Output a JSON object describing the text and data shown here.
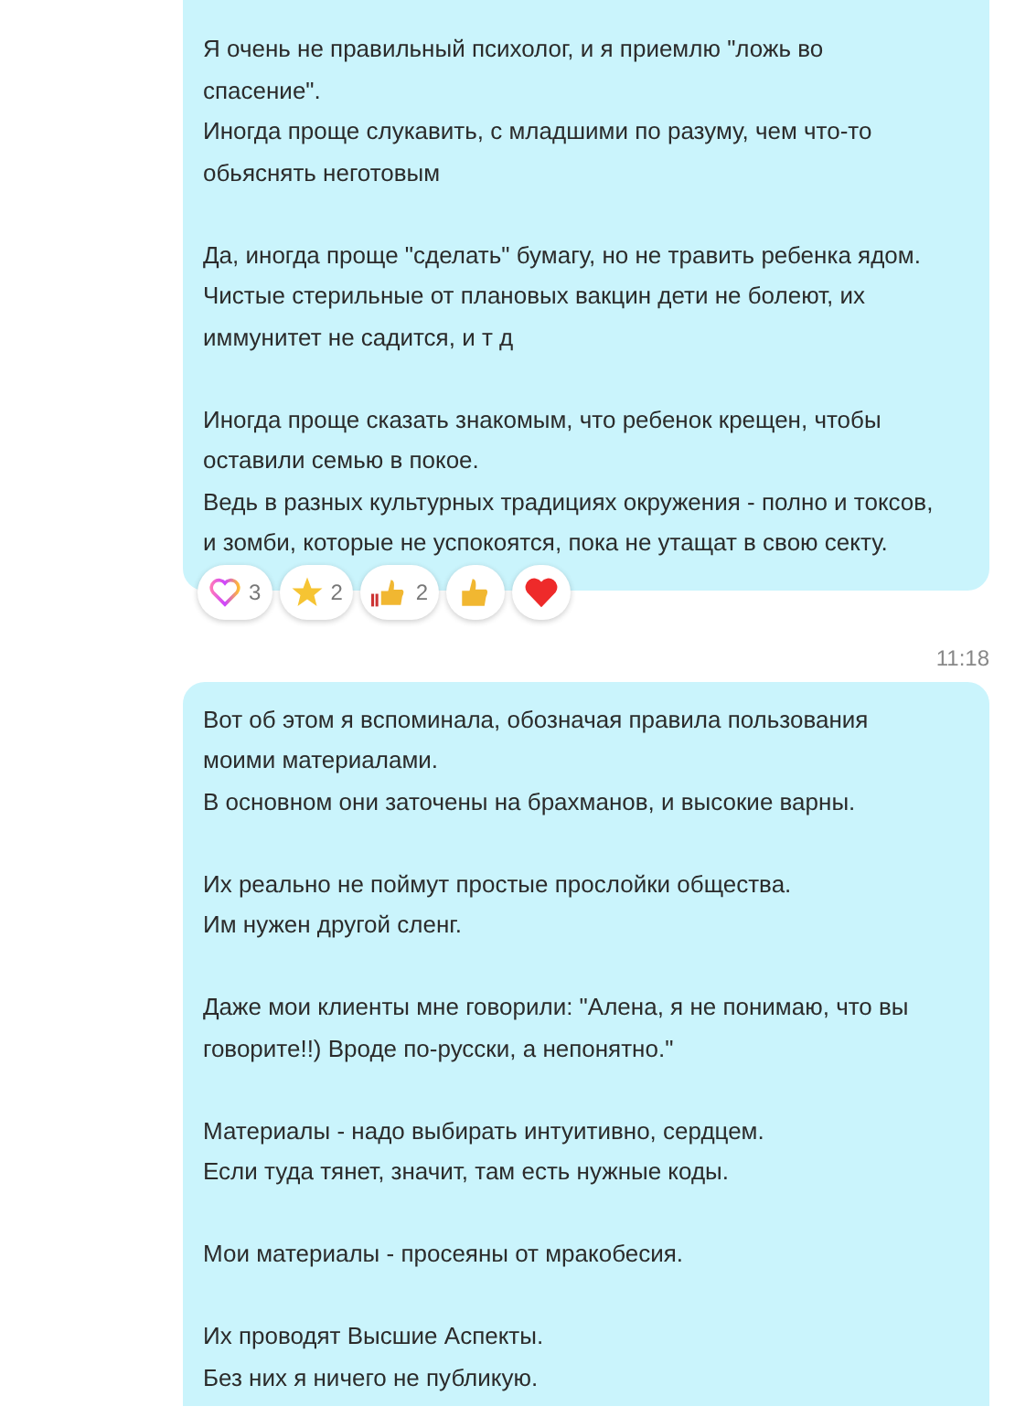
{
  "messages": [
    {
      "paragraphs": [
        [
          "Я очень не правильный психолог, и я приемлю \"ложь во",
          "спасение\".",
          "Иногда проще слукавить, с младшими по разуму, чем что-то",
          "обьяснять неготовым"
        ],
        [
          "Да, иногда проще \"сделать\" бумагу, но не травить ребенка ядом.",
          "Чистые стерильные от плановых вакцин дети не болеют, их",
          "иммунитет не садится, и т д"
        ],
        [
          "Иногда проще сказать знакомым, что ребенок крещен, чтобы",
          "оставили семью в покое.",
          "Ведь в разных культурных традициях окружения - полно и токсов,",
          "и зомби, которые не успокоятся, пока не утащат в свою секту."
        ]
      ],
      "reactions": [
        {
          "kind": "heart-outline",
          "count": "3"
        },
        {
          "kind": "star",
          "count": "2"
        },
        {
          "kind": "thumbs-flag",
          "count": "2"
        },
        {
          "kind": "thumbs"
        },
        {
          "kind": "heart"
        }
      ]
    },
    {
      "time": "11:18",
      "paragraphs": [
        [
          "Вот об этом я вспоминала, обозначая правила пользования",
          "моими материалами.",
          "В основном они заточены на брахманов, и высокие варны."
        ],
        [
          "Их реально не поймут простые прослойки общества.",
          "Им нужен другой сленг."
        ],
        [
          "Даже мои клиенты мне говорили: \"Алена, я не понимаю, что вы",
          "говорите!!) Вроде по-русски, а непонятно.\""
        ],
        [
          "Материалы - надо выбирать интуитивно, сердцем.",
          "Если туда тянет, значит, там есть нужные коды."
        ],
        [
          "Мои материалы - просеяны от мракобесия."
        ],
        [
          "Их проводят Высшие Аспекты.",
          "Без них я ничего не публикую."
        ]
      ]
    }
  ]
}
